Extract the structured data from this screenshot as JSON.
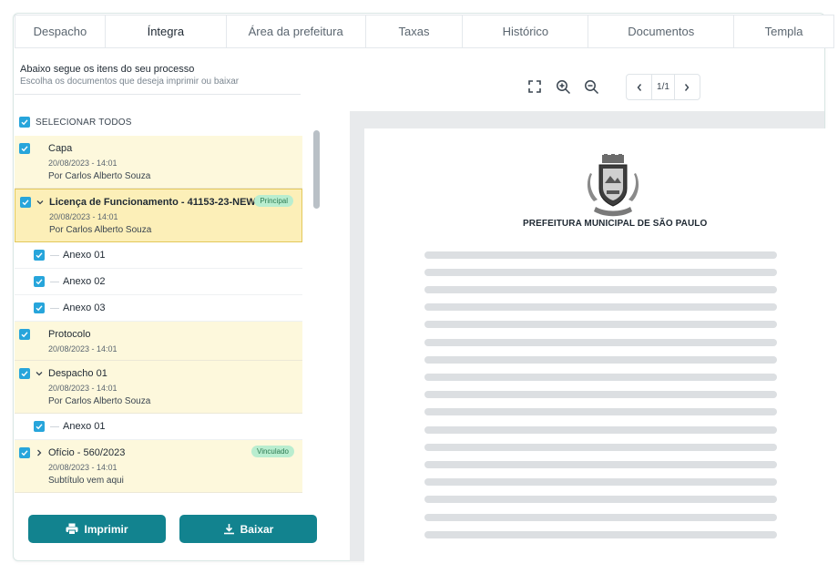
{
  "tabs": [
    {
      "label": "Despacho",
      "active": false
    },
    {
      "label": "Íntegra",
      "active": true
    },
    {
      "label": "Área da prefeitura",
      "active": false
    },
    {
      "label": "Taxas",
      "active": false
    },
    {
      "label": "Histórico",
      "active": false
    },
    {
      "label": "Documentos",
      "active": false
    },
    {
      "label": "Templa",
      "active": false
    }
  ],
  "intro": {
    "title": "Abaixo segue os itens do seu processo",
    "subtitle": "Escolha os documentos que deseja imprimir ou baixar"
  },
  "select_all": {
    "label": "SELECIONAR TODOS",
    "checked": true
  },
  "items": [
    {
      "title": "Capa",
      "date": "20/08/2023 - 14:01",
      "author": "Por Carlos Alberto Souza"
    },
    {
      "title": "Licença de Funcionamento - 41153-23-NEW",
      "date": "20/08/2023 - 14:01",
      "author": "Por Carlos Alberto Souza",
      "badge": "Principal"
    },
    {
      "title": "Anexo 01"
    },
    {
      "title": "Anexo 02"
    },
    {
      "title": "Anexo 03"
    },
    {
      "title": "Protocolo",
      "date": "20/08/2023 - 14:01"
    },
    {
      "title": "Despacho 01",
      "date": "20/08/2023 - 14:01",
      "author": "Por Carlos Alberto Souza"
    },
    {
      "title": "Anexo 01"
    },
    {
      "title": "Ofício - 560/2023",
      "date": "20/08/2023 - 14:01",
      "author": "Subtítulo vem aqui",
      "badge": "Vinculado"
    }
  ],
  "buttons": {
    "print": "Imprimir",
    "download": "Baixar"
  },
  "toolbar": {
    "icons": [
      "fullscreen-icon",
      "zoom-in-icon",
      "zoom-out-icon"
    ],
    "page_indicator": "1/1"
  },
  "document": {
    "org_name": "PREFEITURA MUNICIPAL DE SÃO PAULO"
  },
  "colors": {
    "primary": "#12838f",
    "checkbox": "#27a5db",
    "doc_bg": "#fdf8dc",
    "selected_bg": "#fcefb8",
    "badge_bg": "#b9edcf"
  }
}
